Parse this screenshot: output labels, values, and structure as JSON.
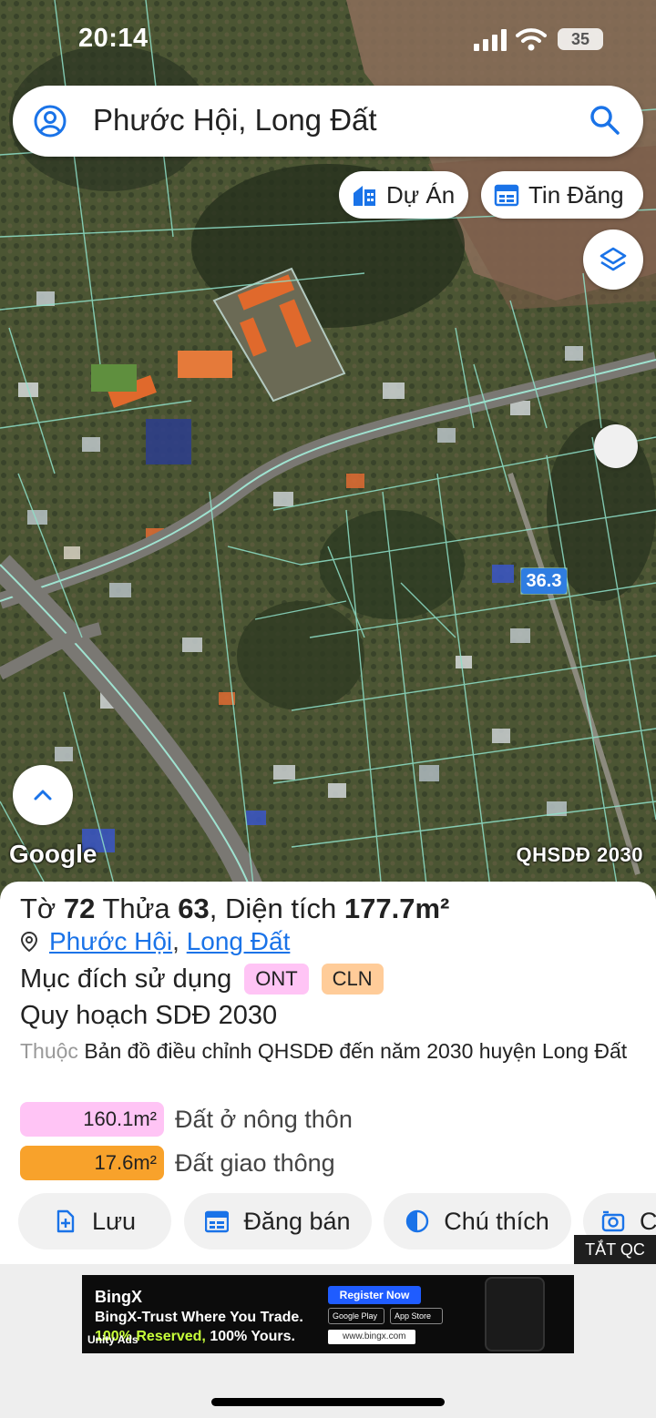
{
  "status_bar": {
    "time": "20:14",
    "battery": "35"
  },
  "search": {
    "query": "Phước Hội, Long Đất"
  },
  "chips": {
    "project": "Dự Án",
    "listing": "Tin Đăng"
  },
  "map": {
    "plot_number_label": "36.3",
    "google_logo": "Google",
    "layer_name": "QHSDĐ 2030"
  },
  "parcel": {
    "title_prefix": "Tờ",
    "sheet_no": "72",
    "plot_prefix": "Thửa",
    "plot_no": "63",
    "area_prefix": ", Diện tích",
    "area": "177.7m²",
    "ward": "Phước Hội",
    "separator": ",",
    "district": "Long Đất",
    "purpose_label": "Mục đích sử dụng",
    "purposes": [
      "ONT",
      "CLN"
    ],
    "plan_label": "Quy hoạch SDĐ 2030",
    "belongs_prefix": "Thuộc",
    "belongs_text": "Bản đồ điều chỉnh QHSDĐ đến năm 2030 huyện Long Đất",
    "zones": [
      {
        "area": "160.1m²",
        "name": "Đất ở nông thôn",
        "color": "#ffc4f5",
        "share": 0.9
      },
      {
        "area": "17.6m²",
        "name": "Đất giao thông",
        "color": "#f8a22b",
        "share": 0.1
      }
    ]
  },
  "actions": {
    "save": "Lưu",
    "sell": "Đăng bán",
    "legend": "Chú thích",
    "photo": "C"
  },
  "ad": {
    "close_label": "TẮT QC",
    "brand": "BingX",
    "tagline_1": "BingX-Trust Where You Trade.",
    "tagline_2a": "100% Reserved, ",
    "tagline_2b": "100% Yours.",
    "unity": "Unity Ads",
    "register": "Register Now",
    "google_play": "Google Play",
    "app_store": "App Store",
    "url": "www.bingx.com"
  }
}
